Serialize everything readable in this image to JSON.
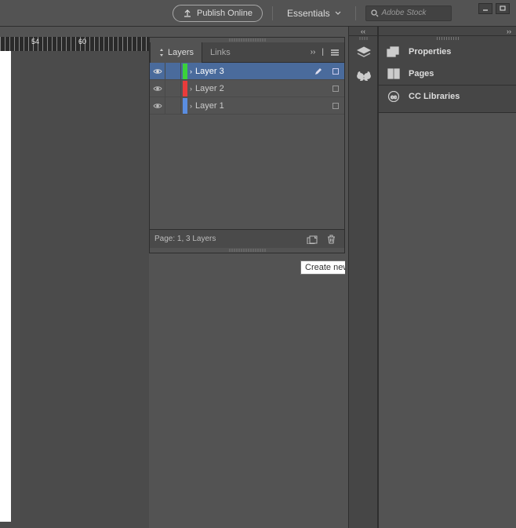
{
  "topbar": {
    "publish_label": "Publish Online",
    "workspace_label": "Essentials",
    "search_placeholder": "Adobe Stock"
  },
  "ruler": {
    "labels": [
      {
        "pos": 40,
        "text": "54"
      },
      {
        "pos": 100,
        "text": "60"
      }
    ]
  },
  "layers_panel": {
    "tabs": [
      {
        "label": "Layers",
        "active": true
      },
      {
        "label": "Links",
        "active": false
      }
    ],
    "layers": [
      {
        "name": "Layer 3",
        "color": "#3bd13b",
        "selected": true,
        "visible": true,
        "has_pen": true
      },
      {
        "name": "Layer 2",
        "color": "#e83b3b",
        "selected": false,
        "visible": true,
        "has_pen": false
      },
      {
        "name": "Layer 1",
        "color": "#5a8de0",
        "selected": false,
        "visible": true,
        "has_pen": false
      }
    ],
    "footer_status": "Page: 1, 3 Layers"
  },
  "tooltip": {
    "text": "Create new layer"
  },
  "right_panels": {
    "items": [
      {
        "name": "Properties"
      },
      {
        "name": "Pages"
      },
      {
        "name": "CC Libraries"
      }
    ]
  }
}
